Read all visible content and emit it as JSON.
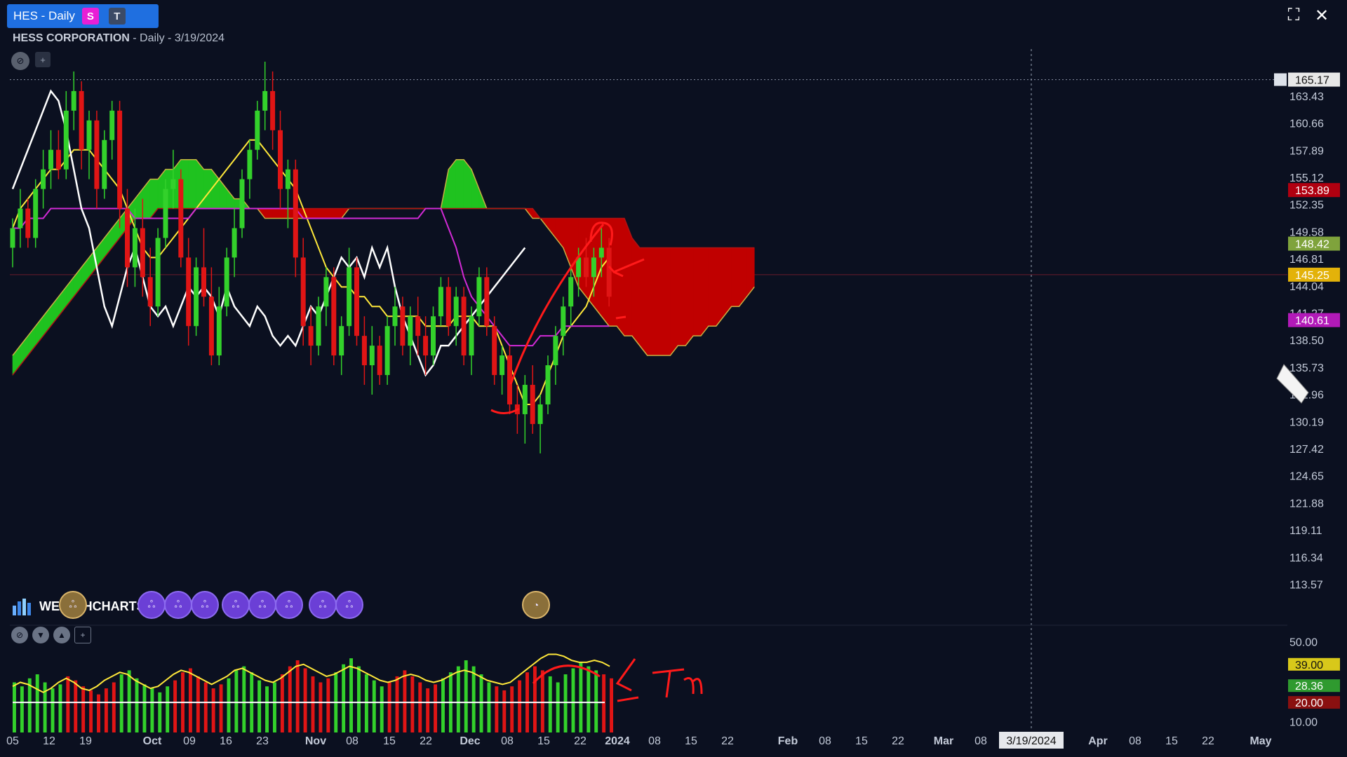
{
  "window": {
    "tab_title": "HES - Daily",
    "badge_s": "S",
    "badge_t": "T",
    "maximize_icon": "⛶",
    "close_icon": "✕"
  },
  "chart_header": {
    "company": "HESS CORPORATION",
    "detail": " - Daily - 3/19/2024"
  },
  "branding": {
    "logo_text": "WEALTHCHARTS"
  },
  "colors": {
    "background": "#0b1020",
    "bull": "#33d12b",
    "bear": "#e01515",
    "cloud_green": "#1fc21f",
    "cloud_red": "#c00000",
    "tenkan": "#ffe83a",
    "kijun": "#d22ad6",
    "chikou": "#ffffff",
    "annotation": "#ff1a1a"
  },
  "chart_data": [
    {
      "type": "candlestick",
      "title": "HESS CORPORATION - Daily - 3/19/2024",
      "indicator": "Ichimoku cloud",
      "x_tick_labels": [
        "05",
        "12",
        "19",
        "Oct",
        "09",
        "16",
        "23",
        "Nov",
        "08",
        "15",
        "22",
        "Dec",
        "08",
        "15",
        "22",
        "2024",
        "08",
        "15",
        "22",
        "Feb",
        "08",
        "15",
        "22",
        "Mar",
        "08",
        "3/19/2024",
        "Apr",
        "08",
        "15",
        "22",
        "May"
      ],
      "y_tick_labels": [
        "165.17",
        "163.43",
        "160.66",
        "157.89",
        "155.12",
        "152.35",
        "149.58",
        "146.81",
        "144.04",
        "141.27",
        "138.50",
        "135.73",
        "132.96",
        "130.19",
        "127.42",
        "124.65",
        "121.88",
        "119.11",
        "116.34",
        "113.57"
      ],
      "ylim": [
        112.6,
        167.0
      ],
      "price_tags": [
        {
          "value": 165.17,
          "label": "165.17",
          "color": "#e8e8e8",
          "text_color": "#111111"
        },
        {
          "value": 153.89,
          "label": "153.89",
          "color": "#b00010",
          "text_color": "#ffffff"
        },
        {
          "value": 148.42,
          "label": "148.42",
          "color": "#7fa33c",
          "text_color": "#ffffff"
        },
        {
          "value": 145.25,
          "label": "145.25",
          "color": "#e3b20a",
          "text_color": "#ffffff"
        },
        {
          "value": 140.61,
          "label": "140.61",
          "color": "#b21ab8",
          "text_color": "#ffffff"
        }
      ],
      "candles": [
        [
          148,
          151,
          146,
          150
        ],
        [
          150,
          154,
          148,
          152
        ],
        [
          152,
          153,
          148,
          149
        ],
        [
          149,
          155,
          148,
          154
        ],
        [
          154,
          158,
          152,
          156
        ],
        [
          156,
          160,
          154,
          158
        ],
        [
          158,
          160,
          155,
          156
        ],
        [
          156,
          164,
          155,
          162
        ],
        [
          162,
          166,
          160,
          164
        ],
        [
          164,
          165,
          156,
          158
        ],
        [
          158,
          162,
          155,
          161
        ],
        [
          161,
          162,
          152,
          154
        ],
        [
          154,
          160,
          153,
          159
        ],
        [
          159,
          163,
          157,
          162
        ],
        [
          162,
          163,
          150,
          152
        ],
        [
          152,
          154,
          144,
          146
        ],
        [
          146,
          152,
          144,
          150
        ],
        [
          150,
          153,
          143,
          145
        ],
        [
          145,
          148,
          140,
          142
        ],
        [
          142,
          150,
          141,
          149
        ],
        [
          149,
          155,
          148,
          154
        ],
        [
          154,
          158,
          152,
          155
        ],
        [
          155,
          156,
          146,
          147
        ],
        [
          147,
          149,
          138,
          140
        ],
        [
          140,
          147,
          139,
          146
        ],
        [
          146,
          150,
          142,
          143
        ],
        [
          143,
          146,
          136,
          137
        ],
        [
          137,
          144,
          136,
          142
        ],
        [
          142,
          148,
          141,
          147
        ],
        [
          147,
          152,
          145,
          150
        ],
        [
          150,
          156,
          149,
          155
        ],
        [
          155,
          159,
          153,
          158
        ],
        [
          158,
          163,
          157,
          162
        ],
        [
          162,
          167,
          160,
          164
        ],
        [
          164,
          166,
          158,
          160
        ],
        [
          160,
          162,
          152,
          154
        ],
        [
          154,
          157,
          150,
          156
        ],
        [
          156,
          157,
          145,
          147
        ],
        [
          147,
          149,
          138,
          140
        ],
        [
          140,
          142,
          136,
          138
        ],
        [
          138,
          143,
          137,
          142
        ],
        [
          142,
          146,
          140,
          145
        ],
        [
          145,
          146,
          136,
          137
        ],
        [
          137,
          141,
          135,
          140
        ],
        [
          140,
          148,
          139,
          146
        ],
        [
          146,
          147,
          138,
          139
        ],
        [
          139,
          141,
          134,
          136
        ],
        [
          136,
          140,
          133,
          138
        ],
        [
          138,
          139,
          134,
          135
        ],
        [
          135,
          141,
          134,
          140
        ],
        [
          140,
          144,
          138,
          142
        ],
        [
          142,
          143,
          137,
          138
        ],
        [
          138,
          142,
          136,
          141
        ],
        [
          141,
          143,
          137,
          139
        ],
        [
          139,
          141,
          135,
          137
        ],
        [
          137,
          142,
          136,
          141
        ],
        [
          141,
          145,
          140,
          144
        ],
        [
          144,
          145,
          139,
          140
        ],
        [
          140,
          144,
          138,
          143
        ],
        [
          143,
          144,
          136,
          137
        ],
        [
          137,
          142,
          135,
          141
        ],
        [
          141,
          146,
          140,
          145
        ],
        [
          145,
          146,
          139,
          140
        ],
        [
          140,
          141,
          134,
          135
        ],
        [
          135,
          138,
          133,
          137
        ],
        [
          137,
          138,
          131,
          132
        ],
        [
          132,
          134,
          129,
          131
        ],
        [
          131,
          135,
          128,
          134
        ],
        [
          134,
          136,
          129,
          130
        ],
        [
          130,
          133,
          127,
          132
        ],
        [
          132,
          137,
          131,
          136
        ],
        [
          136,
          140,
          134,
          139
        ],
        [
          139,
          143,
          137,
          142
        ],
        [
          142,
          146,
          140,
          145
        ],
        [
          145,
          148,
          143,
          147
        ],
        [
          147,
          149,
          144,
          145
        ],
        [
          145,
          148,
          143,
          147
        ],
        [
          147,
          150,
          145,
          148
        ],
        [
          148,
          149,
          142,
          143
        ]
      ],
      "series": [
        {
          "name": "",
          "kind": "tenkan",
          "values": [
            150,
            152,
            153,
            154,
            155,
            156,
            156,
            157,
            158,
            158,
            158,
            157,
            156,
            155,
            154,
            152,
            150,
            148,
            147,
            147,
            148,
            149,
            150,
            151,
            152,
            153,
            154,
            155,
            156,
            157,
            158,
            159,
            159,
            158,
            157,
            156,
            155,
            154,
            152,
            150,
            148,
            146,
            145,
            144,
            144,
            143,
            143,
            142,
            142,
            141,
            141,
            141,
            141,
            141,
            140,
            140,
            140,
            140,
            141,
            141,
            141,
            140,
            140,
            140,
            138,
            136,
            134,
            132,
            132,
            133,
            135,
            137,
            139,
            140,
            141,
            142,
            144,
            146,
            147
          ]
        },
        {
          "name": "",
          "kind": "kijun",
          "values": [
            150,
            150,
            151,
            151,
            151,
            152,
            152,
            152,
            152,
            152,
            152,
            152,
            152,
            152,
            152,
            152,
            151,
            151,
            151,
            151,
            151,
            151,
            151,
            151,
            152,
            152,
            152,
            152,
            152,
            152,
            152,
            152,
            152,
            152,
            152,
            152,
            152,
            152,
            151,
            151,
            151,
            151,
            151,
            151,
            151,
            151,
            151,
            151,
            151,
            151,
            151,
            151,
            151,
            151,
            152,
            152,
            152,
            150,
            148,
            145,
            143,
            142,
            141,
            140,
            139,
            138,
            138,
            138,
            138,
            139,
            139,
            139,
            140,
            140,
            140,
            140,
            140,
            140,
            140
          ]
        },
        {
          "name": "",
          "kind": "chikou",
          "values": [
            154,
            156,
            158,
            160,
            162,
            164,
            163,
            160,
            156,
            152,
            150,
            146,
            142,
            140,
            143,
            146,
            148,
            145,
            142,
            141,
            142,
            140,
            142,
            144,
            143,
            144,
            143,
            141,
            144,
            142,
            141,
            140,
            142,
            141,
            139,
            138,
            139,
            138,
            140,
            142,
            141,
            143,
            145,
            147,
            146,
            147,
            145,
            148,
            146,
            148,
            144,
            141,
            139,
            137,
            135,
            136,
            138,
            138,
            139,
            140,
            141,
            142,
            143,
            144,
            145,
            146,
            147,
            148
          ]
        }
      ],
      "cloud": {
        "span_a": [
          137,
          138,
          139,
          140,
          141,
          142,
          143,
          144,
          145,
          146,
          147,
          148,
          149,
          150,
          151,
          152,
          153,
          154,
          155,
          155,
          156,
          156,
          157,
          157,
          157,
          156,
          156,
          155,
          154,
          153,
          153,
          152,
          152,
          151,
          151,
          151,
          151,
          151,
          151,
          151,
          151,
          151,
          151,
          151,
          152,
          152,
          152,
          152,
          152,
          152,
          152,
          152,
          152,
          152,
          152,
          152,
          152,
          156,
          157,
          157,
          156,
          154,
          152,
          152,
          152,
          152,
          152,
          152,
          151,
          151,
          150,
          149,
          148,
          146,
          144,
          143,
          142,
          141,
          140,
          140,
          139,
          139,
          138,
          137,
          137,
          137,
          137,
          138,
          138,
          139,
          139,
          140,
          140,
          141,
          142,
          142,
          143,
          144
        ],
        "span_b": [
          135,
          136,
          137,
          138,
          139,
          140,
          141,
          142,
          143,
          144,
          145,
          146,
          147,
          148,
          149,
          150,
          151,
          151,
          151,
          152,
          152,
          152,
          152,
          152,
          152,
          152,
          152,
          152,
          152,
          152,
          152,
          152,
          152,
          152,
          152,
          152,
          152,
          152,
          152,
          152,
          152,
          152,
          152,
          152,
          152,
          152,
          152,
          152,
          152,
          152,
          152,
          152,
          152,
          152,
          152,
          152,
          152,
          152,
          152,
          152,
          152,
          152,
          152,
          152,
          152,
          152,
          152,
          152,
          152,
          151,
          151,
          151,
          151,
          151,
          151,
          151,
          151,
          151,
          151,
          151,
          151,
          149,
          148,
          148,
          148,
          148,
          148,
          148,
          148,
          148,
          148,
          148,
          148,
          148,
          148,
          148,
          148,
          148
        ]
      }
    },
    {
      "type": "bar",
      "title": "",
      "indicator": "oscillator (green/red histogram with yellow line)",
      "y_tick_labels": [
        "50.00",
        "20.00",
        "10.00"
      ],
      "ylim": [
        5,
        55
      ],
      "price_tags": [
        {
          "value": 39.0,
          "label": "39.00",
          "color": "#d8c81a",
          "text_color": "#111111"
        },
        {
          "value": 28.36,
          "label": "28.36",
          "color": "#2f9a2f",
          "text_color": "#ffffff"
        },
        {
          "value": 20.0,
          "label": "20.00",
          "color": "#8a1010",
          "text_color": "#ffffff"
        }
      ],
      "histogram": [
        30,
        28,
        32,
        34,
        30,
        27,
        29,
        33,
        31,
        28,
        26,
        24,
        27,
        30,
        34,
        36,
        32,
        29,
        27,
        25,
        28,
        31,
        35,
        37,
        33,
        30,
        27,
        29,
        32,
        36,
        38,
        35,
        31,
        28,
        30,
        34,
        38,
        41,
        37,
        33,
        30,
        32,
        35,
        39,
        42,
        38,
        34,
        31,
        28,
        30,
        33,
        36,
        33,
        30,
        27,
        29,
        32,
        35,
        38,
        41,
        38,
        34,
        30,
        28,
        26,
        28,
        31,
        35,
        38,
        36,
        33,
        30,
        34,
        37,
        40,
        38,
        36,
        34,
        32
      ],
      "line": [
        28,
        30,
        29,
        27,
        25,
        27,
        30,
        32,
        30,
        27,
        26,
        28,
        31,
        33,
        35,
        34,
        31,
        29,
        27,
        28,
        31,
        34,
        36,
        35,
        33,
        31,
        29,
        31,
        33,
        36,
        37,
        35,
        33,
        31,
        30,
        32,
        35,
        38,
        39,
        37,
        35,
        33,
        34,
        36,
        38,
        37,
        35,
        33,
        31,
        30,
        31,
        33,
        34,
        33,
        31,
        30,
        31,
        33,
        35,
        36,
        35,
        33,
        31,
        30,
        29,
        30,
        33,
        36,
        39,
        42,
        44,
        44,
        43,
        41,
        40,
        40,
        41,
        40,
        38
      ],
      "baseline": 20
    }
  ]
}
